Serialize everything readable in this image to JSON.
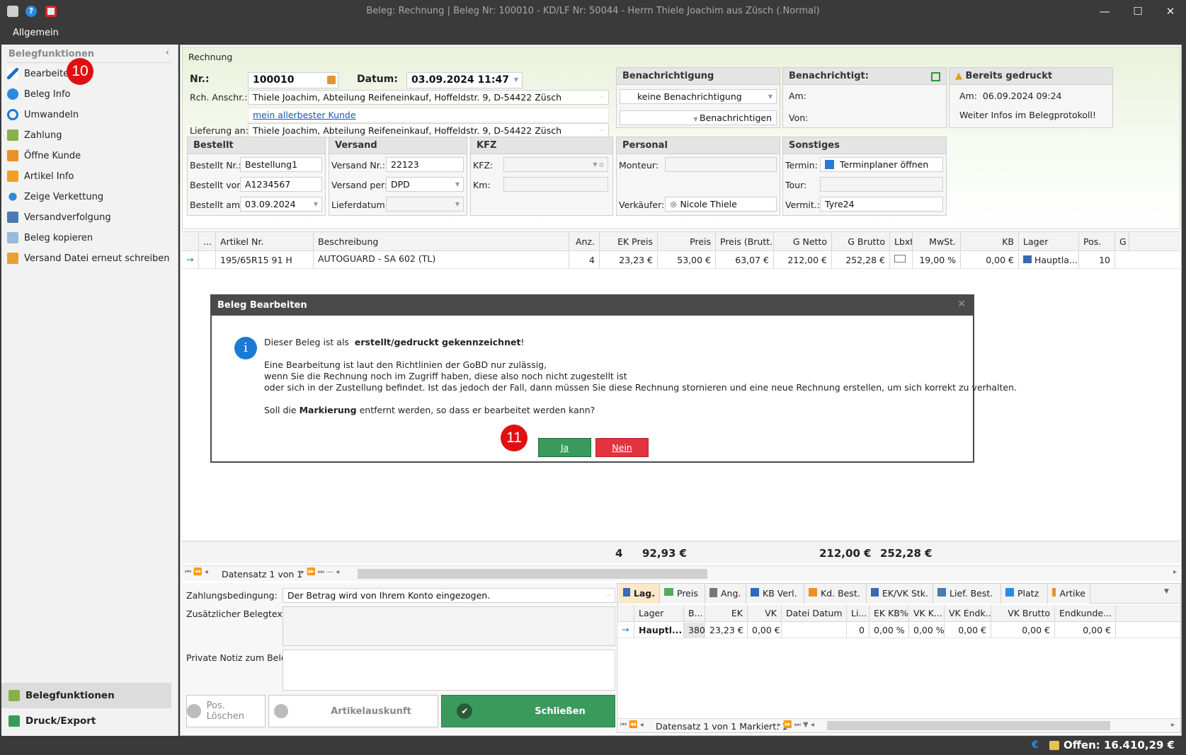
{
  "window": {
    "title": "Beleg: Rechnung | Beleg Nr: 100010 -  KD/LF Nr: 50044 - Herrn Thiele Joachim aus Züsch (.Normal)"
  },
  "menu": {
    "allgemein": "Allgemein"
  },
  "sidebar": {
    "header": "Belegfunktionen",
    "items": [
      {
        "label": "Bearbeiten",
        "icon": "pencil-icon"
      },
      {
        "label": "Beleg Info",
        "icon": "info-icon"
      },
      {
        "label": "Umwandeln",
        "icon": "convert-icon"
      },
      {
        "label": "Zahlung",
        "icon": "payment-icon"
      },
      {
        "label": "Öffne Kunde",
        "icon": "customer-icon"
      },
      {
        "label": "Artikel Info",
        "icon": "article-icon"
      },
      {
        "label": "Zeige Verkettung",
        "icon": "chain-icon"
      },
      {
        "label": "Versandverfolgung",
        "icon": "tracking-icon"
      },
      {
        "label": "Beleg kopieren",
        "icon": "copy-icon"
      },
      {
        "label": "Versand Datei erneut schreiben",
        "icon": "file-write-icon"
      }
    ],
    "footer": [
      "Belegfunktionen",
      "Druck/Export"
    ]
  },
  "badges": {
    "b10": "10",
    "b11": "11"
  },
  "form": {
    "section_title": "Rechnung",
    "nr_label": "Nr.:",
    "nr_value": "100010",
    "datum_label": "Datum:",
    "datum_value": "03.09.2024 11:47",
    "rch_label": "Rch. Anschr.:",
    "rch_value": "Thiele Joachim, Abteilung Reifeneinkauf, Hoffeldstr. 9,  D-54422 Züsch",
    "link": "mein allerbester Kunde",
    "lief_label": "Lieferung an:",
    "lief_value": "Thiele Joachim, Abteilung Reifeneinkauf, Hoffeldstr. 9,  D-54422 Züsch",
    "benachrichtigung": {
      "title": "Benachrichtigung",
      "select": "keine Benachrichtigung",
      "button": "Benachrichtigen"
    },
    "benachrichtigt": {
      "title": "Benachrichtigt:",
      "am": "Am:",
      "von": "Von:"
    },
    "gedruckt": {
      "title": "Bereits gedruckt",
      "am_label": "Am:",
      "am_value": "06.09.2024 09:24",
      "info": "Weiter Infos im Belegprotokoll!"
    },
    "bestellt": {
      "title": "Bestellt",
      "nr_label": "Bestellt Nr.:",
      "nr": "Bestellung1",
      "von_label": "Bestellt von:",
      "von": "A1234567",
      "am_label": "Bestellt am:",
      "am": "03.09.2024"
    },
    "versand": {
      "title": "Versand",
      "nr_label": "Versand Nr.:",
      "nr": "22123",
      "per_label": "Versand per:",
      "per": "DPD",
      "datum_label": "Lieferdatum:"
    },
    "kfz": {
      "title": "KFZ",
      "kfz_label": "KFZ:",
      "km_label": "Km:"
    },
    "personal": {
      "title": "Personal",
      "monteur_label": "Monteur:",
      "verk_label": "Verkäufer:",
      "verk": "Nicole Thiele"
    },
    "sonstiges": {
      "title": "Sonstiges",
      "termin_label": "Termin:",
      "termin": "Terminplaner öffnen",
      "tour_label": "Tour:",
      "vermit_label": "Vermit.:",
      "vermit": "Tyre24"
    }
  },
  "grid": {
    "columns": [
      "...",
      "Artikel Nr.",
      "Beschreibung",
      "Anz.",
      "EK Preis",
      "Preis",
      "Preis (Brutt...",
      "G Netto",
      "G Brutto",
      "Lbxt",
      "MwSt.",
      "KB",
      "Lager",
      "Pos.",
      "G"
    ],
    "row": {
      "artikel": "195/65R15 91 H",
      "beschreibung": "AUTOGUARD - SA 602 (TL)",
      "anz": "4",
      "ek": "23,23 €",
      "preis": "53,00 €",
      "brutto": "63,07 €",
      "gnetto": "212,00 €",
      "gbrutto": "252,28 €",
      "mwst": "19,00 %",
      "kb": "0,00 €",
      "lager": "Hauptla...",
      "pos": "10"
    },
    "sum": {
      "anz": "4",
      "ek": "92,93 €",
      "gnetto": "212,00 €",
      "gbrutto": "252,28 €"
    },
    "nav": "Datensatz 1 von 1"
  },
  "dialog": {
    "title": "Beleg Bearbeiten",
    "line1a": "Dieser Beleg ist als",
    "line1b": "erstellt/gedruckt gekennzeichnet",
    "line1c": "!",
    "p1": "Eine Bearbeitung ist laut den Richtlinien der GoBD nur zulässig,",
    "p2": "wenn Sie die Rechnung noch im Zugriff haben, diese also noch nicht zugestellt ist",
    "p3": "oder sich in der Zustellung befindet. Ist das jedoch der Fall, dann müssen Sie diese Rechnung stornieren und eine neue Rechnung erstellen, um sich korrekt zu verhalten.",
    "q1": "Soll die",
    "q2": "Markierung",
    "q3": "entfernt werden, so dass er bearbeitet werden kann?",
    "yes": "Ja",
    "no": "Nein"
  },
  "bottom": {
    "zahl_label": "Zahlungsbedingung:",
    "zahl_value": "Der Betrag wird von Ihrem Konto eingezogen.",
    "zusatz_label": "Zusätzlicher Belegtext:",
    "notiz_label": "Private Notiz zum Beleg:",
    "btn_pos": "Pos. Löschen",
    "btn_art": "Artikelauskunft",
    "btn_close": "Schließen"
  },
  "subtabs": [
    "Lag.",
    "Preis",
    "Ang.",
    "KB Verl.",
    "Kd. Best.",
    "EK/VK Stk.",
    "Lief. Best.",
    "Platz",
    "Artike"
  ],
  "subgrid": {
    "columns": [
      "Lager",
      "B...",
      "EK",
      "VK",
      "Datei Datum",
      "Li...",
      "EK KB%",
      "VK K...",
      "VK Endk...",
      "VK Brutto",
      "Endkunde..."
    ],
    "row": [
      "Hauptl...",
      "380",
      "23,23 €",
      "0,00 €",
      "",
      "0",
      "0,00 %",
      "0,00 %",
      "0,00 €",
      "0,00 €",
      "0,00 €"
    ],
    "nav": "Datensatz 1 von 1 Markiert: 1"
  },
  "status": {
    "offen": "Offen: 16.410,29 €"
  },
  "colors": {
    "yes": "#3a9a5c",
    "no": "#e0343f",
    "badge": "#e01010",
    "info": "#1a7ad4"
  }
}
